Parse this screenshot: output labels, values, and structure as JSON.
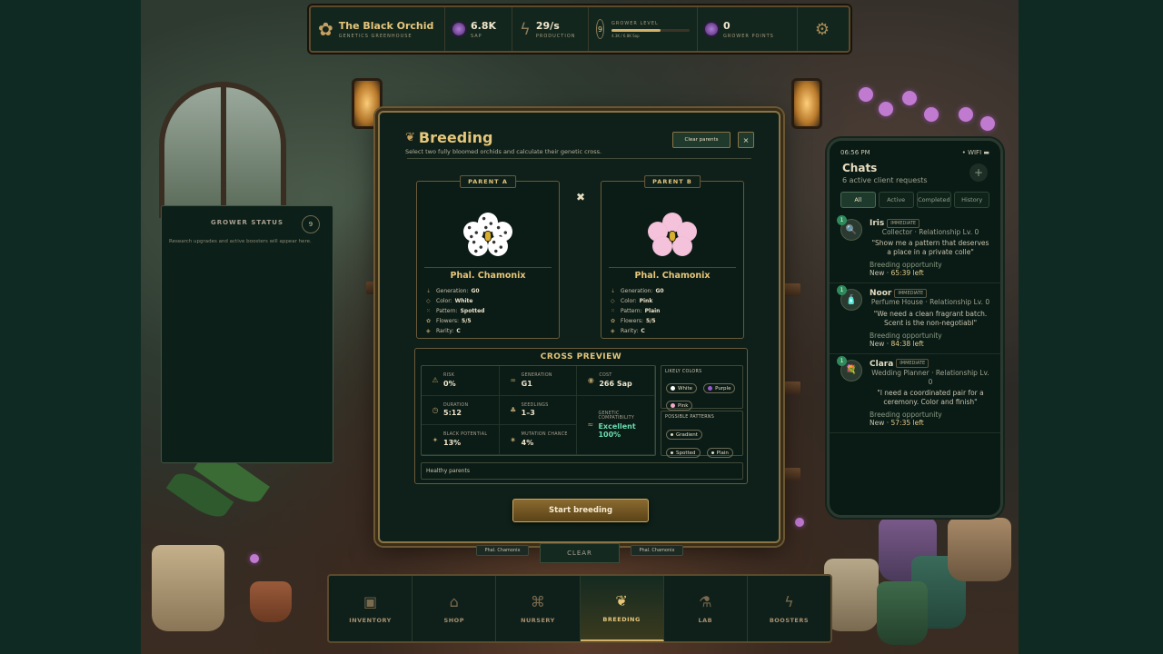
{
  "hud": {
    "brand_title": "The Black Orchid",
    "brand_sub": "GENETICS GREENHOUSE",
    "sap_value": "6.8K",
    "sap_label": "SAP",
    "production_value": "29/s",
    "production_label": "PRODUCTION",
    "grower_level": "9",
    "grower_level_label": "GROWER LEVEL",
    "grower_level_progress": "4.3K / 6.8K Sap",
    "grower_level_fill": 0.63,
    "grower_points_value": "0",
    "grower_points_label": "GROWER POINTS"
  },
  "grower_status": {
    "title": "GROWER STATUS",
    "level": "9",
    "text": "Research upgrades and active boosters will appear here."
  },
  "modal": {
    "title": "Breeding",
    "description": "Select two fully bloomed orchids and calculate their genetic cross.",
    "clear_parents": "Clear parents",
    "close": "×",
    "cross_symbol": "✖",
    "parent_a": {
      "label": "PARENT A",
      "name": "Phal. Chamonix",
      "petal_color": "#ffffff",
      "attrs": [
        {
          "label": "Generation:",
          "value": "G0"
        },
        {
          "label": "Color:",
          "value": "White"
        },
        {
          "label": "Pattern:",
          "value": "Spotted"
        },
        {
          "label": "Flowers:",
          "value": "5/5"
        },
        {
          "label": "Rarity:",
          "value": "C"
        }
      ]
    },
    "parent_b": {
      "label": "PARENT B",
      "name": "Phal. Chamonix",
      "petal_color": "#f4c2da",
      "attrs": [
        {
          "label": "Generation:",
          "value": "G0"
        },
        {
          "label": "Color:",
          "value": "Pink"
        },
        {
          "label": "Pattern:",
          "value": "Plain"
        },
        {
          "label": "Flowers:",
          "value": "5/5"
        },
        {
          "label": "Rarity:",
          "value": "C"
        }
      ]
    },
    "preview": {
      "title": "CROSS PREVIEW",
      "risk_label": "RISK",
      "risk": "0%",
      "generation_label": "GENERATION",
      "generation": "G1",
      "cost_label": "COST",
      "cost": "266 Sap",
      "duration_label": "DURATION",
      "duration": "5:12",
      "seedlings_label": "SEEDLINGS",
      "seedlings": "1–3",
      "compat_label": "GENETIC COMPATIBILITY",
      "compat": "Excellent",
      "compat_pct": "100%",
      "black_label": "BLACK POTENTIAL",
      "black": "13%",
      "mutation_label": "MUTATION CHANCE",
      "mutation": "4%",
      "likely_colors_label": "LIKELY COLORS",
      "likely_colors": [
        {
          "name": "White",
          "color": "#ffffff"
        },
        {
          "name": "Purple",
          "color": "#9a5ad0"
        },
        {
          "name": "Pink",
          "color": "#f4a8cc"
        }
      ],
      "patterns_label": "POSSIBLE PATTERNS",
      "patterns": [
        "Gradient",
        "Spotted",
        "Plain"
      ],
      "health_note": "Healthy parents"
    },
    "start_button": "Start breeding"
  },
  "under_modal": {
    "left_chip": "Phal. Chamonix",
    "clear_tab": "CLEAR",
    "right_chip": "Phal. Chamonix"
  },
  "phone": {
    "time": "06:56 PM",
    "signal": "• WIFI ▬",
    "title": "Chats",
    "subtitle": "6 active client requests",
    "plus": "+",
    "tabs": [
      "All",
      "Active",
      "Completed",
      "History"
    ],
    "requests": [
      {
        "name": "Iris",
        "tag": "IMMEDIATE",
        "badge": "1",
        "icon": "🔍",
        "role": "Collector · Relationship Lv. 0",
        "quote": "\"Show me a pattern that deserves a place in a private colle\"",
        "opportunity": "Breeding opportunity",
        "status": "New · ",
        "time": "65:39 left"
      },
      {
        "name": "Noor",
        "tag": "IMMEDIATE",
        "badge": "1",
        "icon": "🧴",
        "role": "Perfume House · Relationship Lv. 0",
        "quote": "\"We need a clean fragrant batch. Scent is the non-negotiabl\"",
        "opportunity": "Breeding opportunity",
        "status": "New · ",
        "time": "84:38 left"
      },
      {
        "name": "Clara",
        "tag": "IMMEDIATE",
        "badge": "1",
        "icon": "💐",
        "role": "Wedding Planner · Relationship Lv. 0",
        "quote": "\"I need a coordinated pair for a ceremony. Color and finish\"",
        "opportunity": "Breeding opportunity",
        "status": "New · ",
        "time": "57:35 left"
      }
    ]
  },
  "nav": {
    "items": [
      {
        "label": "INVENTORY",
        "icon": "▣"
      },
      {
        "label": "SHOP",
        "icon": "⌂"
      },
      {
        "label": "NURSERY",
        "icon": "⌘"
      },
      {
        "label": "BREEDING",
        "icon": "❦"
      },
      {
        "label": "LAB",
        "icon": "⚗"
      },
      {
        "label": "BOOSTERS",
        "icon": "ϟ"
      }
    ],
    "active": "BREEDING"
  }
}
